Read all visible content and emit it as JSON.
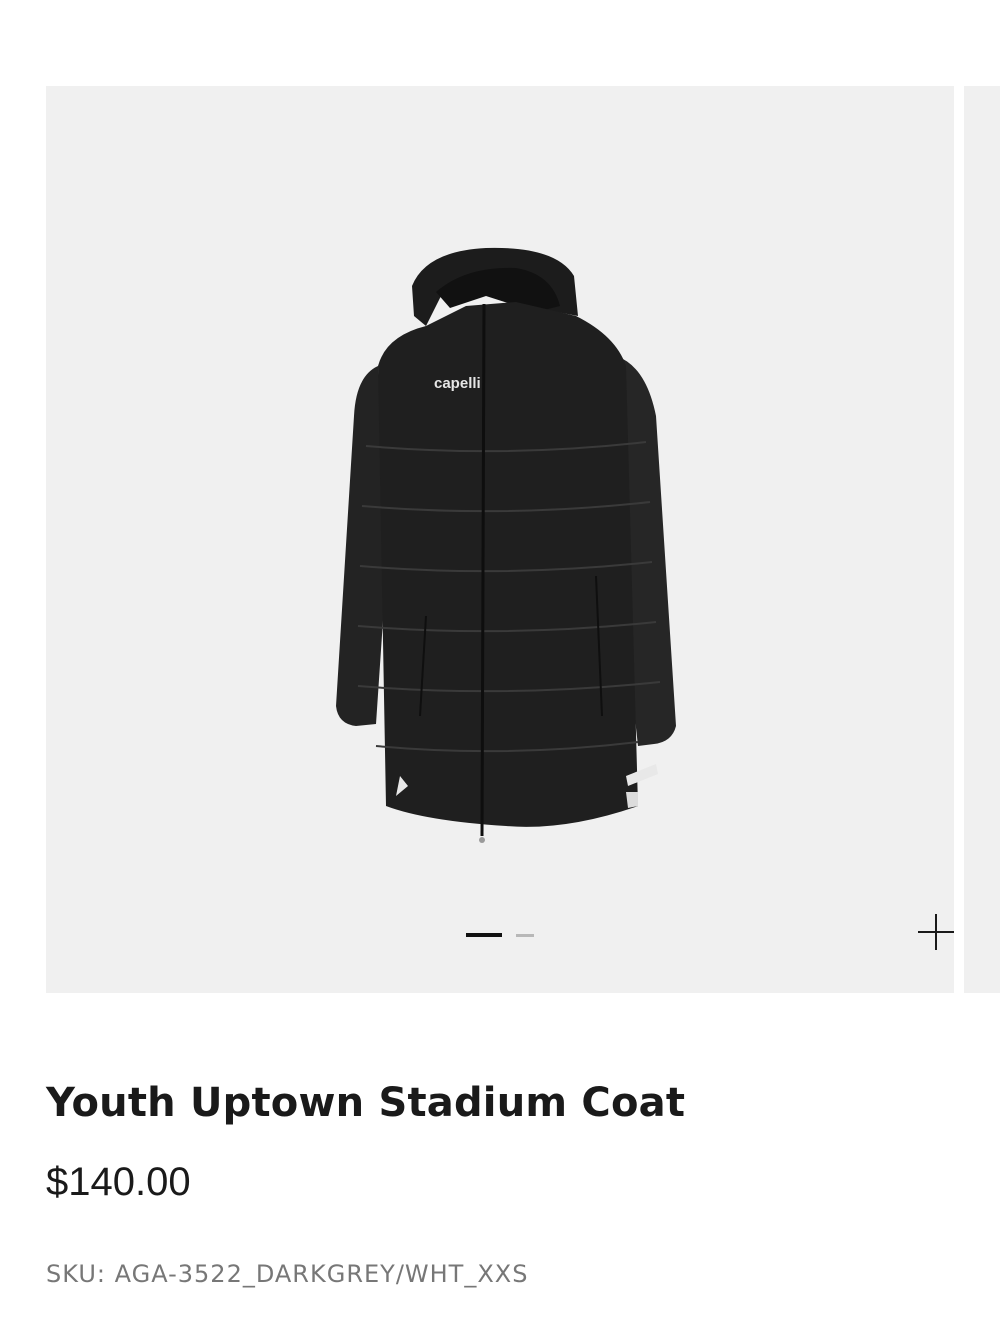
{
  "gallery": {
    "image_alt": "Youth Uptown Stadium Coat",
    "brand_logo_text": "capelli",
    "slide_count": 2,
    "active_slide": 1,
    "zoom_icon": "plus-icon"
  },
  "product": {
    "title": "Youth Uptown Stadium Coat",
    "price": "$140.00",
    "sku": "SKU: AGA-3522_DARKGREY/WHT_XXS"
  },
  "colors": {
    "gallery_background": "#f0f0f0",
    "coat": "#1f1f1f",
    "text_primary": "#1a1a1a",
    "text_secondary": "#777777"
  }
}
